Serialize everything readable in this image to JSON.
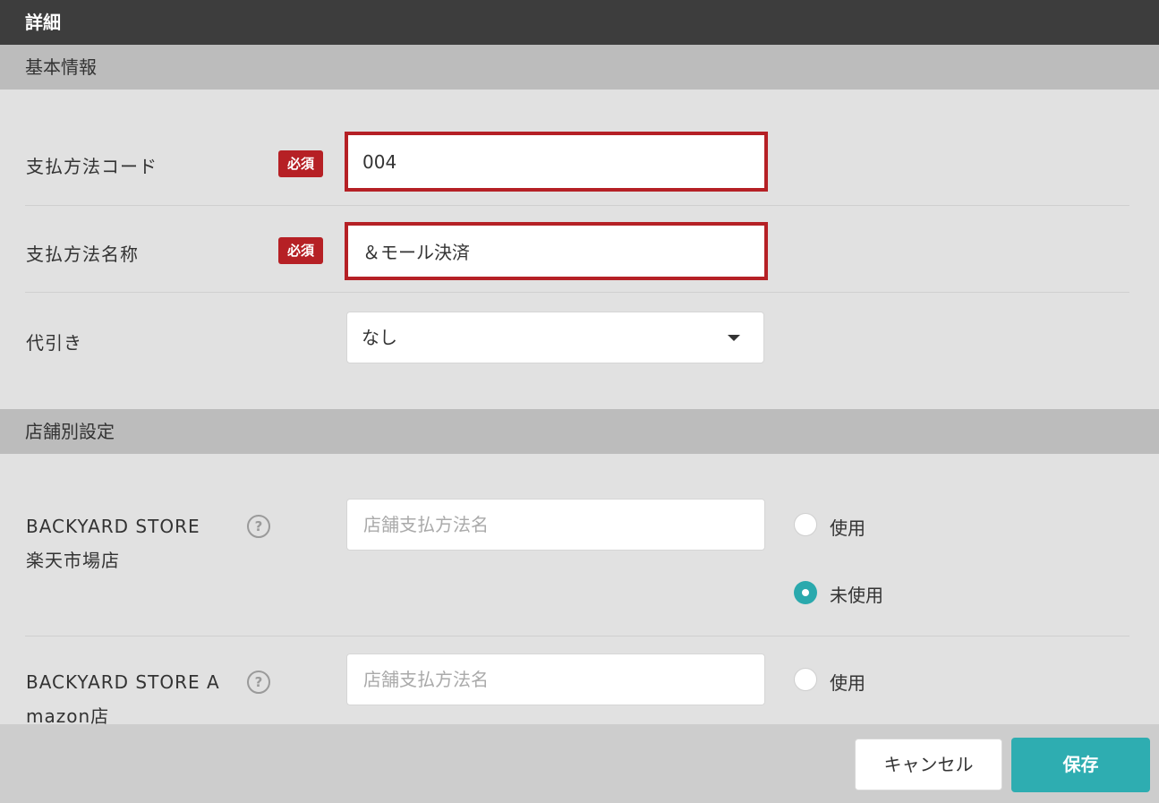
{
  "title": "詳細",
  "basic_section": {
    "header": "基本情報",
    "code": {
      "label": "支払方法コード",
      "required": "必須",
      "value": "004"
    },
    "name": {
      "label": "支払方法名称",
      "required": "必須",
      "value": "＆モール決済"
    },
    "cod": {
      "label": "代引き",
      "selected": "なし"
    }
  },
  "store_section": {
    "header": "店舗別設定",
    "stores": [
      {
        "name_line1": "BACKYARD STORE",
        "name_line2": "楽天市場店",
        "placeholder": "店舗支払方法名",
        "use_label": "使用",
        "unused_label": "未使用",
        "selected": "未使用"
      },
      {
        "name_line1": "BACKYARD STORE A",
        "name_line2": "mazon店",
        "placeholder": "店舗支払方法名",
        "use_label": "使用"
      }
    ]
  },
  "help_glyph": "?",
  "footer": {
    "cancel_label": "キャンセル",
    "save_label": "保存"
  },
  "colors": {
    "accent": "#2aa9ad",
    "required": "#b62025",
    "titlebar": "#3d3d3d"
  },
  "icons": [
    "help-icon",
    "dropdown-arrow-icon"
  ]
}
